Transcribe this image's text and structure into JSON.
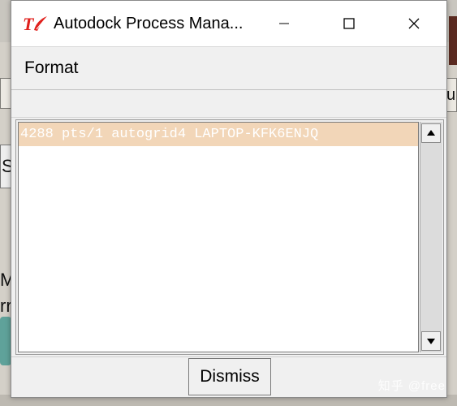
{
  "window": {
    "title": "Autodock Process Mana...",
    "icon": "tk-feather-icon",
    "controls": [
      "minimize-icon",
      "maximize-icon",
      "close-icon"
    ]
  },
  "menu": {
    "items": [
      {
        "label": "Format"
      }
    ]
  },
  "process_list": {
    "rows": [
      {
        "text": "4288  pts/1 autogrid4 LAPTOP-KFK6ENJQ",
        "selected": true
      }
    ],
    "selection_color": "#f2d6b8"
  },
  "footer": {
    "dismiss_label": "Dismiss"
  },
  "background": {
    "left_button_fragment": "Sa",
    "left_text_1": "M",
    "left_text_2": "rr",
    "right_button_fragment": "u",
    "watermark": "知乎 @free"
  }
}
